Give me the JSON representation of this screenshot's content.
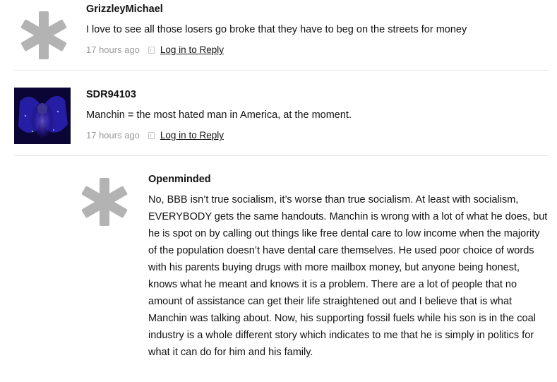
{
  "comments": [
    {
      "author": "GrizzleyMichael",
      "text": "I love to see all those losers go broke that they have to beg on the streets for money",
      "time": "17 hours ago",
      "reply_label": "Log in to Reply",
      "avatar": "default-asterisk-avatar"
    },
    {
      "author": "SDR94103",
      "text": "Manchin = the most hated man in America, at the moment.",
      "time": "17 hours ago",
      "reply_label": "Log in to Reply",
      "avatar": "photo-avatar"
    },
    {
      "author": "Openminded",
      "text": "No, BBB isn’t true socialism, it’s worse than true socialism. At least with socialism, EVERYBODY gets the same handouts. Manchin is wrong with a lot of what he does, but he is spot on by calling out things like free dental care to low income when the majority of the population doesn’t have dental care themselves. He used poor choice of words with his parents buying drugs with more mailbox money, but anyone being honest, knows what he meant and knows it is a problem. There are a lot of people that no amount of assistance can get their life straightened out and I believe that is what Manchin was talking about. Now, his supporting fossil fuels while his son is in the coal industry is a whole different story which indicates to me that he is simply in politics for what it can do for him and his family.",
      "avatar": "default-asterisk-avatar"
    }
  ],
  "colors": {
    "avatar_gray": "#b3b3b3",
    "meta_gray": "#9a9a9a",
    "divider": "#e6e6e6"
  }
}
